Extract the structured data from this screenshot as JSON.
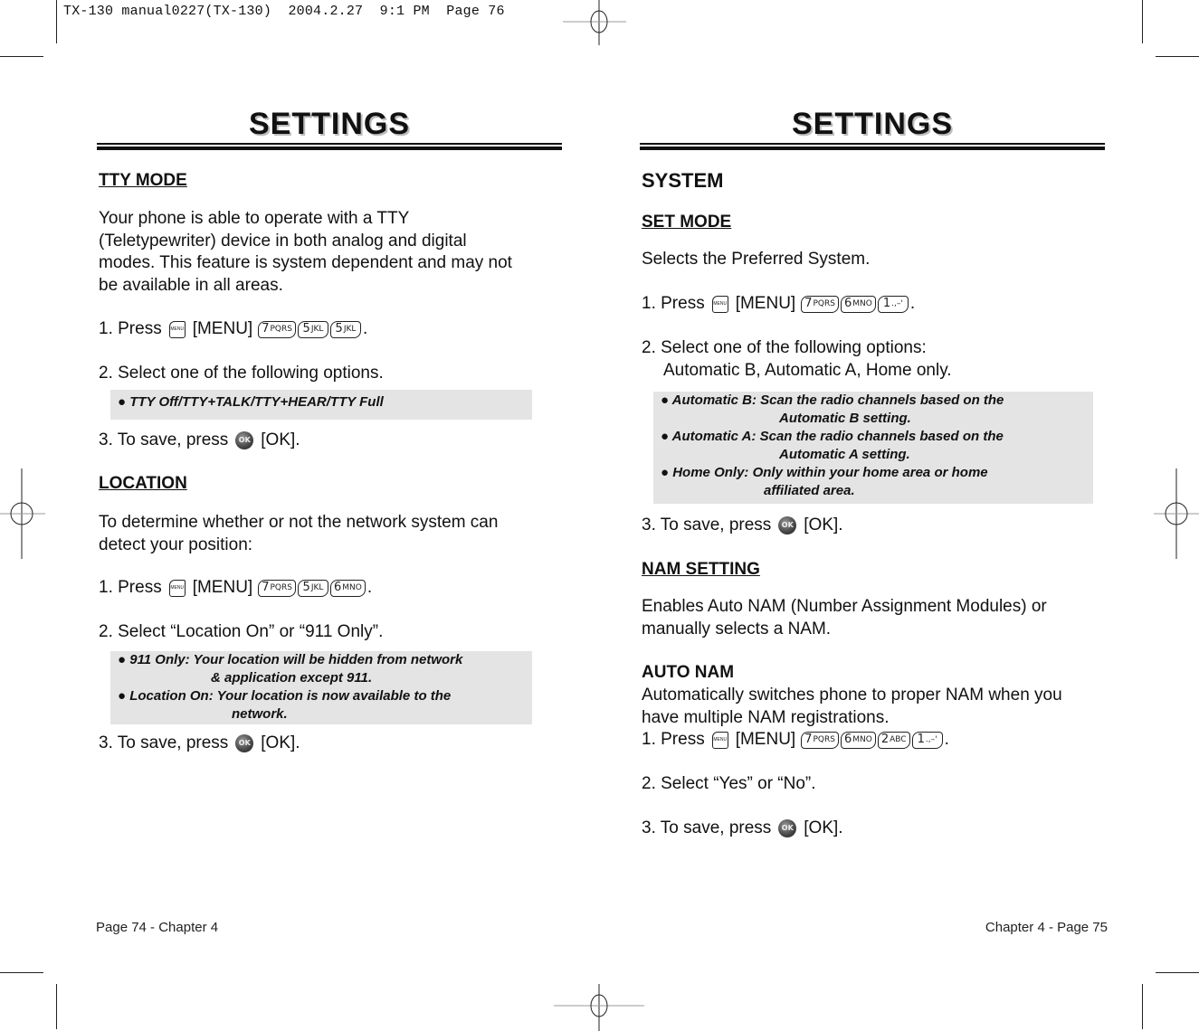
{
  "slug": "TX-130 manual0227(TX-130)  2004.2.27  9:1 PM  Page 76",
  "left_page": {
    "title": "SETTINGS",
    "tty_mode": {
      "heading": "TTY MODE",
      "description": [
        "Your phone is able to operate with a TTY",
        "(Teletypewriter) device in both analog and digital",
        "modes. This feature is system dependent and may not",
        "be available in all areas."
      ],
      "step1": {
        "prefix": "1. Press",
        "menu_label": "[MENU]",
        "keys": [
          {
            "digit": "7",
            "letters": "PQRS"
          },
          {
            "digit": "5",
            "letters": "JKL"
          },
          {
            "digit": "5",
            "letters": "JKL"
          }
        ],
        "suffix": "."
      },
      "step2": "2. Select one of the following options.",
      "note": [
        "● TTY Off/TTY+TALK/TTY+HEAR/TTY Full"
      ],
      "step3": {
        "prefix": "3. To save, press",
        "ok_label": "[OK]."
      }
    },
    "location": {
      "heading": "LOCATION",
      "description": [
        "To determine whether or not the network system can",
        "detect your position:"
      ],
      "step1": {
        "prefix": "1. Press",
        "menu_label": "[MENU]",
        "keys": [
          {
            "digit": "7",
            "letters": "PQRS"
          },
          {
            "digit": "5",
            "letters": "JKL"
          },
          {
            "digit": "6",
            "letters": "MNO"
          }
        ],
        "suffix": "."
      },
      "step2": "2. Select “Location On” or “911 Only”.",
      "note": [
        {
          "lead": "● 911 Only: Your location will be hidden from network",
          "cont": "& application except 911."
        },
        {
          "lead": "● Location On: Your location is now available to the",
          "cont": "network."
        }
      ],
      "step3": {
        "prefix": "3. To save, press",
        "ok_label": "[OK]."
      }
    },
    "footer": "Page 74 - Chapter 4"
  },
  "right_page": {
    "title": "SETTINGS",
    "system_heading": "SYSTEM",
    "set_mode": {
      "heading": "SET MODE",
      "description": "Selects the Preferred System.",
      "step1": {
        "prefix": "1. Press",
        "menu_label": "[MENU]",
        "keys": [
          {
            "digit": "7",
            "letters": "PQRS"
          },
          {
            "digit": "6",
            "letters": "MNO"
          },
          {
            "digit": "1",
            "letters": ".,–'"
          }
        ],
        "suffix": "."
      },
      "step2": [
        "2. Select one of the following options:",
        "Automatic B, Automatic A, Home only."
      ],
      "note": [
        {
          "lead": "● Automatic B: Scan the radio channels based on the",
          "cont": "Automatic B setting."
        },
        {
          "lead": "● Automatic A: Scan the radio channels based on the",
          "cont": "Automatic A setting."
        },
        {
          "lead": "● Home Only: Only within your home area or home",
          "cont": "affiliated area."
        }
      ],
      "step3": {
        "prefix": "3. To save, press",
        "ok_label": "[OK]."
      }
    },
    "nam_setting": {
      "heading": "NAM SETTING",
      "description": [
        "Enables Auto NAM (Number Assignment Modules) or",
        "manually selects a NAM."
      ]
    },
    "auto_nam": {
      "heading": "AUTO NAM",
      "description": [
        "Automatically switches phone to proper NAM when you",
        "have multiple NAM registrations."
      ],
      "step1": {
        "prefix": "1. Press",
        "menu_label": "[MENU]",
        "keys": [
          {
            "digit": "7",
            "letters": "PQRS"
          },
          {
            "digit": "6",
            "letters": "MNO"
          },
          {
            "digit": "2",
            "letters": "ABC"
          },
          {
            "digit": "1",
            "letters": ".,–'"
          }
        ],
        "suffix": "."
      },
      "step2": "2. Select “Yes” or “No”.",
      "step3": {
        "prefix": "3. To save, press",
        "ok_label": "[OK]."
      }
    },
    "footer": "Chapter 4 - Page 75"
  },
  "icons": {
    "menu_key": "MENU",
    "ok_key": "OK"
  }
}
